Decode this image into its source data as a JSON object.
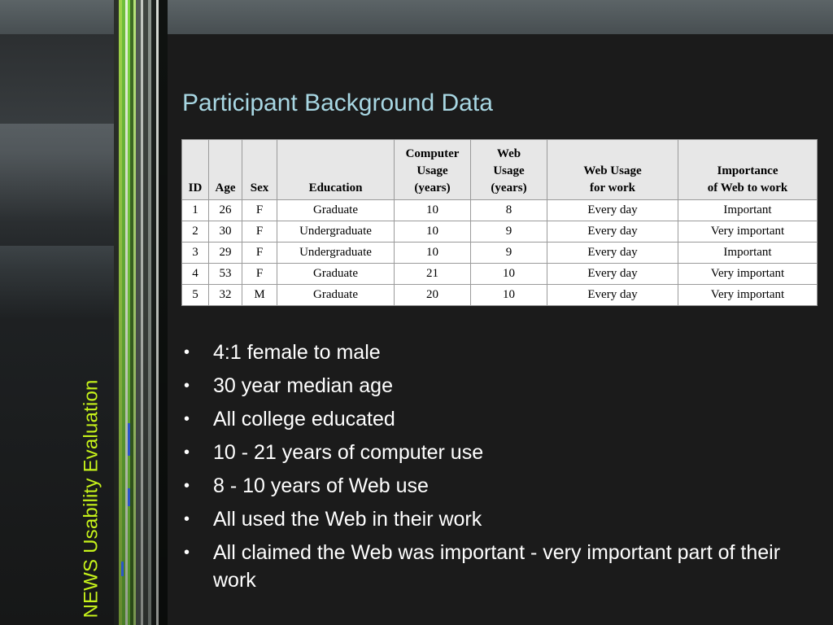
{
  "slide": {
    "title": "Participant Background Data",
    "side_caption": "NEWS Usability Evaluation"
  },
  "table": {
    "headers": [
      [
        "ID"
      ],
      [
        "Age"
      ],
      [
        "Sex"
      ],
      [
        "Education"
      ],
      [
        "Computer",
        "Usage",
        "(years)"
      ],
      [
        "Web",
        "Usage",
        "(years)"
      ],
      [
        "Web Usage",
        "for work"
      ],
      [
        "Importance",
        "of Web to work"
      ]
    ],
    "rows": [
      [
        "1",
        "26",
        "F",
        "Graduate",
        "10",
        "8",
        "Every day",
        "Important"
      ],
      [
        "2",
        "30",
        "F",
        "Undergraduate",
        "10",
        "9",
        "Every day",
        "Very important"
      ],
      [
        "3",
        "29",
        "F",
        "Undergraduate",
        "10",
        "9",
        "Every day",
        "Important"
      ],
      [
        "4",
        "53",
        "F",
        "Graduate",
        "21",
        "10",
        "Every day",
        "Very important"
      ],
      [
        "5",
        "32",
        "M",
        "Graduate",
        "20",
        "10",
        "Every day",
        "Very important"
      ]
    ]
  },
  "bullets": [
    "4:1 female to male",
    "30 year median age",
    "All college educated",
    "10 - 21 years of computer use",
    "8 - 10 years of Web use",
    "All used the Web in their work",
    "All claimed the Web was important - very important part of their work"
  ],
  "colors": {
    "background": "#1b1b1b",
    "title": "#a8d7e3",
    "side_caption": "#c6f21a",
    "bullet_text": "#ffffff"
  }
}
